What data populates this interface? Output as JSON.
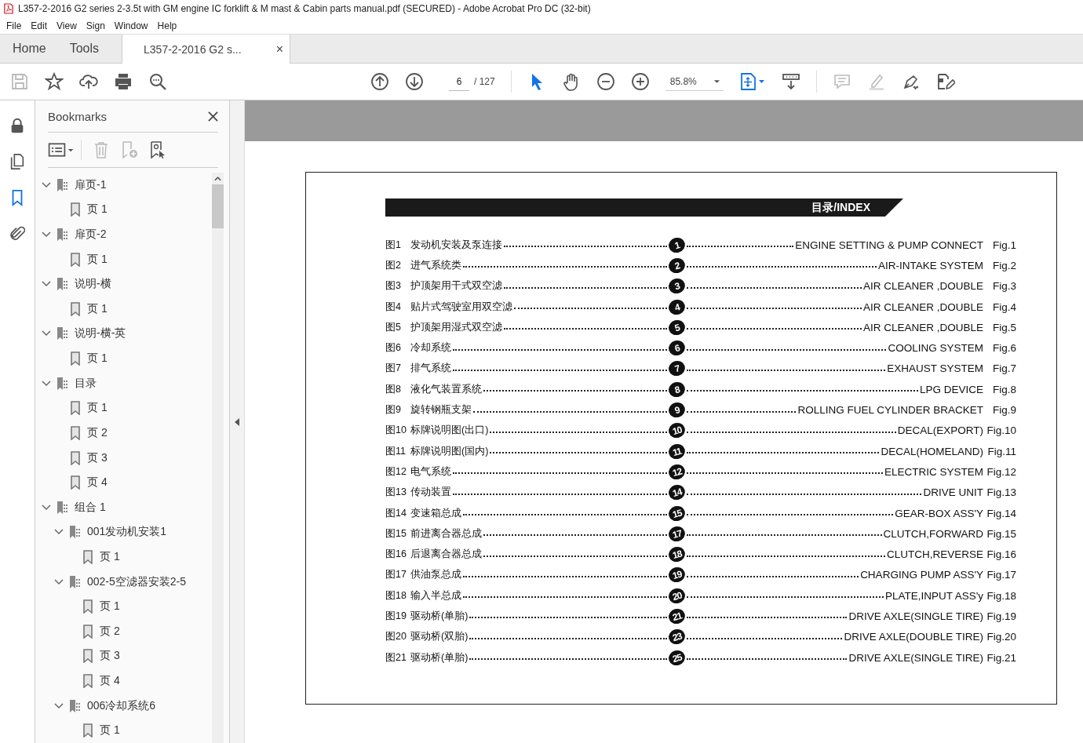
{
  "window": {
    "title": "L357-2-2016 G2 series 2-3.5t with GM engine IC forklift & M mast & Cabin parts manual.pdf (SECURED) - Adobe Acrobat Pro DC (32-bit)"
  },
  "menu": [
    "File",
    "Edit",
    "View",
    "Sign",
    "Window",
    "Help"
  ],
  "tabs": [
    {
      "label": "Home",
      "kind": "nav",
      "selected": false
    },
    {
      "label": "Tools",
      "kind": "nav",
      "selected": false
    },
    {
      "label": "L357-2-2016 G2 s...",
      "kind": "document",
      "selected": true,
      "close": "×"
    }
  ],
  "toolbar": {
    "page": "6",
    "page_count": "/ 127",
    "zoom": "85.8%"
  },
  "side_rail": [
    {
      "kind": "lock",
      "selected": false
    },
    {
      "kind": "pages",
      "selected": false
    },
    {
      "kind": "bookmarks",
      "selected": true
    },
    {
      "kind": "attachments",
      "selected": false
    }
  ],
  "bookmarks": {
    "title": "Bookmarks",
    "tree": [
      {
        "label": "扉页-1",
        "kind": "group",
        "expanded": true,
        "children": [
          {
            "label": "页 1",
            "kind": "page"
          }
        ]
      },
      {
        "label": "扉页-2",
        "kind": "group",
        "expanded": true,
        "children": [
          {
            "label": "页 1",
            "kind": "page"
          }
        ]
      },
      {
        "label": "说明-横",
        "kind": "group",
        "expanded": true,
        "children": [
          {
            "label": "页 1",
            "kind": "page"
          }
        ]
      },
      {
        "label": "说明-横-英",
        "kind": "group",
        "expanded": true,
        "children": [
          {
            "label": "页 1",
            "kind": "page"
          }
        ]
      },
      {
        "label": "目录",
        "kind": "group",
        "expanded": true,
        "children": [
          {
            "label": "页 1",
            "kind": "page"
          },
          {
            "label": "页 2",
            "kind": "page"
          },
          {
            "label": "页 3",
            "kind": "page"
          },
          {
            "label": "页 4",
            "kind": "page"
          }
        ]
      },
      {
        "label": "组合 1",
        "kind": "group",
        "expanded": true,
        "children": [
          {
            "label": "001发动机安装1",
            "kind": "group",
            "expanded": true,
            "children": [
              {
                "label": "页 1",
                "kind": "page"
              }
            ]
          },
          {
            "label": "002-5空滤器安装2-5",
            "kind": "group",
            "expanded": true,
            "children": [
              {
                "label": "页 1",
                "kind": "page"
              },
              {
                "label": "页 2",
                "kind": "page"
              },
              {
                "label": "页 3",
                "kind": "page"
              },
              {
                "label": "页 4",
                "kind": "page"
              }
            ]
          },
          {
            "label": "006冷却系统6",
            "kind": "group",
            "expanded": true,
            "children": [
              {
                "label": "页 1",
                "kind": "page"
              }
            ]
          }
        ]
      }
    ]
  },
  "index": {
    "heading": "目录/INDEX",
    "rows": [
      {
        "fig": "图1",
        "cn": "发动机安装及泵连接",
        "num": "1",
        "en": "ENGINE SETTING & PUMP CONNECT",
        "fig_en": "Fig.1"
      },
      {
        "fig": "图2",
        "cn": "进气系统类",
        "num": "2",
        "en": "AIR-INTAKE SYSTEM",
        "fig_en": "Fig.2"
      },
      {
        "fig": "图3",
        "cn": "护顶架用干式双空滤",
        "num": "3",
        "en": "AIR CLEANER ,DOUBLE",
        "fig_en": "Fig.3"
      },
      {
        "fig": "图4",
        "cn": "贴片式驾驶室用双空滤",
        "num": "4",
        "en": "AIR CLEANER ,DOUBLE",
        "fig_en": "Fig.4"
      },
      {
        "fig": "图5",
        "cn": "护顶架用湿式双空滤",
        "num": "5",
        "en": "AIR CLEANER ,DOUBLE",
        "fig_en": "Fig.5"
      },
      {
        "fig": "图6",
        "cn": "冷却系统",
        "num": "6",
        "en": "COOLING SYSTEM",
        "fig_en": "Fig.6"
      },
      {
        "fig": "图7",
        "cn": "排气系统",
        "num": "7",
        "en": "EXHAUST SYSTEM",
        "fig_en": "Fig.7"
      },
      {
        "fig": "图8",
        "cn": "液化气装置系统",
        "num": "8",
        "en": "LPG DEVICE",
        "fig_en": "Fig.8"
      },
      {
        "fig": "图9",
        "cn": "旋转钢瓶支架",
        "num": "9",
        "en": "ROLLING FUEL CYLINDER BRACKET",
        "fig_en": "Fig.9"
      },
      {
        "fig": "图10",
        "cn": "标牌说明图(出口)",
        "num": "10",
        "en": "DECAL(EXPORT)",
        "fig_en": "Fig.10"
      },
      {
        "fig": "图11",
        "cn": "标牌说明图(国内)",
        "num": "11",
        "en": "DECAL(HOMELAND)",
        "fig_en": "Fig.11"
      },
      {
        "fig": "图12",
        "cn": "电气系统",
        "num": "12",
        "en": "ELECTRIC SYSTEM",
        "fig_en": "Fig.12"
      },
      {
        "fig": "图13",
        "cn": "传动装置",
        "num": "14",
        "en": "DRIVE UNIT",
        "fig_en": "Fig.13"
      },
      {
        "fig": "图14",
        "cn": "变速箱总成",
        "num": "15",
        "en": "GEAR-BOX ASS'Y",
        "fig_en": "Fig.14"
      },
      {
        "fig": "图15",
        "cn": "前进离合器总成",
        "num": "17",
        "en": "CLUTCH,FORWARD",
        "fig_en": "Fig.15"
      },
      {
        "fig": "图16",
        "cn": "后退离合器总成",
        "num": "18",
        "en": "CLUTCH,REVERSE",
        "fig_en": "Fig.16"
      },
      {
        "fig": "图17",
        "cn": "供油泵总成",
        "num": "19",
        "en": "CHARGING PUMP ASS'Y",
        "fig_en": "Fig.17"
      },
      {
        "fig": "图18",
        "cn": "输入半总成",
        "num": "20",
        "en": "PLATE,INPUT ASS'y",
        "fig_en": "Fig.18"
      },
      {
        "fig": "图19",
        "cn": "驱动桥(单胎)",
        "num": "21",
        "en": "DRIVE AXLE(SINGLE TIRE)",
        "fig_en": "Fig.19"
      },
      {
        "fig": "图20",
        "cn": "驱动桥(双胎)",
        "num": "23",
        "en": "DRIVE AXLE(DOUBLE TIRE)",
        "fig_en": "Fig.20"
      },
      {
        "fig": "图21",
        "cn": "驱动桥(单胎)",
        "num": "25",
        "en": "DRIVE AXLE(SINGLE TIRE)",
        "fig_en": "Fig.21"
      }
    ]
  }
}
